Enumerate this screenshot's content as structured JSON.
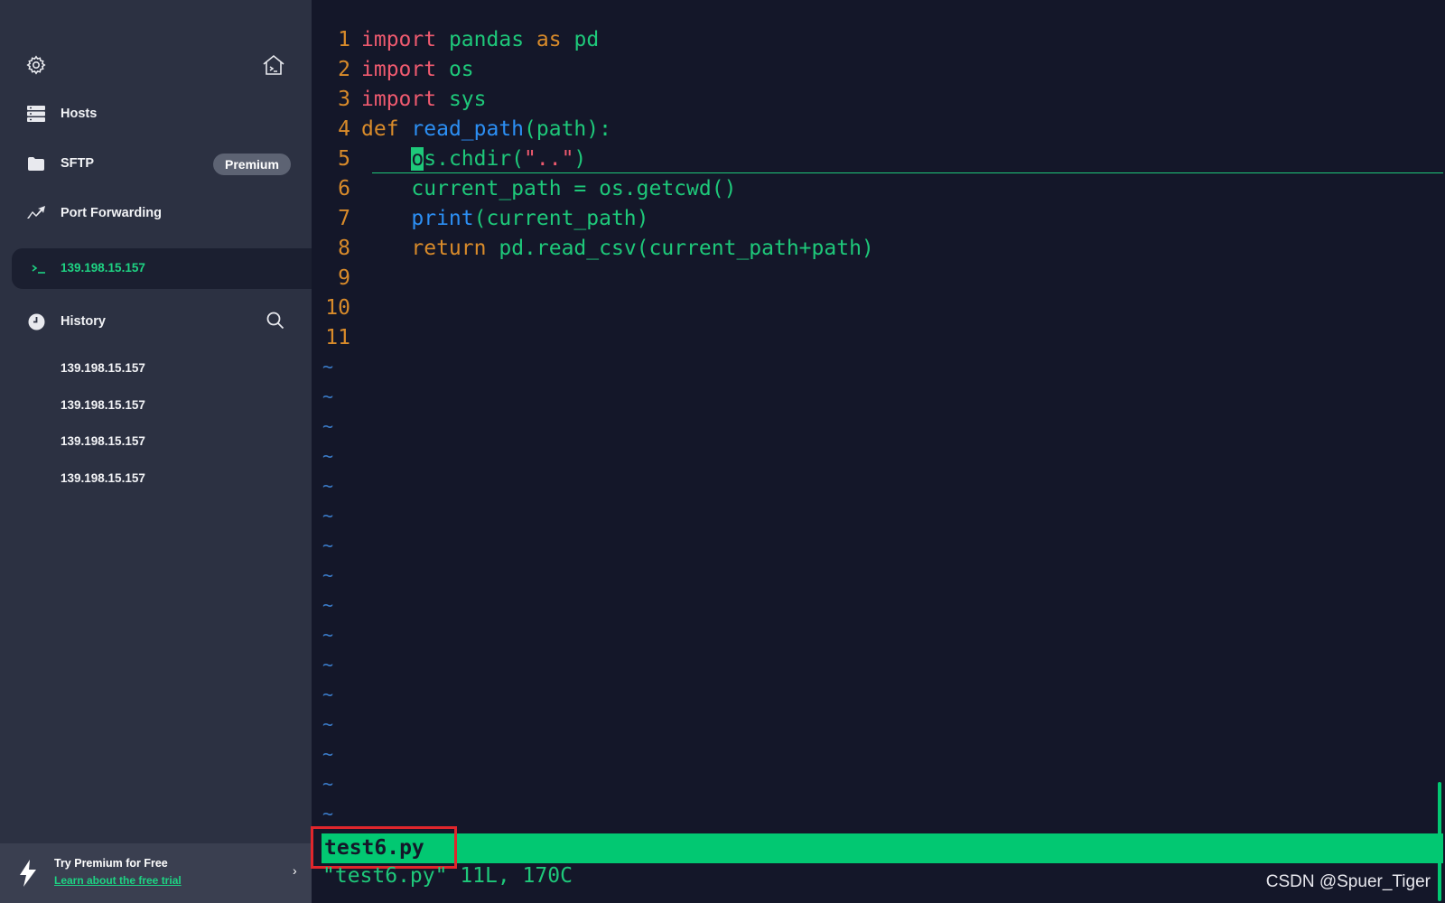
{
  "sidebar": {
    "nav": {
      "hosts": "Hosts",
      "sftp": "SFTP",
      "sftp_badge": "Premium",
      "port_forwarding": "Port Forwarding"
    },
    "active_session": "139.198.15.157",
    "history": {
      "label": "History",
      "items": [
        "139.198.15.157",
        "139.198.15.157",
        "139.198.15.157",
        "139.198.15.157"
      ]
    },
    "footer": {
      "title": "Try Premium for Free",
      "link": "Learn about the free trial",
      "chevron": "›"
    }
  },
  "window": {
    "minimize": "—",
    "maximize": "☐",
    "close": "✕",
    "dropdown": "⌄"
  },
  "terminal": {
    "lines": [
      {
        "n": "1",
        "tokens": [
          {
            "t": "kw",
            "v": "import"
          },
          {
            "t": "plain",
            "v": " "
          },
          {
            "t": "id",
            "v": "pandas"
          },
          {
            "t": "plain",
            "v": " "
          },
          {
            "t": "def",
            "v": "as"
          },
          {
            "t": "plain",
            "v": " "
          },
          {
            "t": "id",
            "v": "pd"
          }
        ]
      },
      {
        "n": "2",
        "tokens": [
          {
            "t": "kw",
            "v": "import"
          },
          {
            "t": "plain",
            "v": " "
          },
          {
            "t": "id",
            "v": "os"
          }
        ]
      },
      {
        "n": "3",
        "tokens": [
          {
            "t": "kw",
            "v": "import"
          },
          {
            "t": "plain",
            "v": " "
          },
          {
            "t": "id",
            "v": "sys"
          }
        ]
      },
      {
        "n": "4",
        "tokens": [
          {
            "t": "def",
            "v": "def"
          },
          {
            "t": "plain",
            "v": " "
          },
          {
            "t": "fn",
            "v": "read_path"
          },
          {
            "t": "id",
            "v": "(path):"
          }
        ]
      },
      {
        "n": "5",
        "tokens": [
          {
            "t": "plain",
            "v": "    "
          },
          {
            "t": "cursor",
            "v": "o"
          },
          {
            "t": "id",
            "v": "s.chdir("
          },
          {
            "t": "str",
            "v": "\"..\""
          },
          {
            "t": "id",
            "v": ")"
          }
        ]
      },
      {
        "n": "6",
        "tokens": [
          {
            "t": "plain",
            "v": "    "
          },
          {
            "t": "id",
            "v": "current_path = os.getcwd()"
          }
        ]
      },
      {
        "n": "7",
        "tokens": [
          {
            "t": "plain",
            "v": "    "
          },
          {
            "t": "fn",
            "v": "print"
          },
          {
            "t": "id",
            "v": "(current_path)"
          }
        ]
      },
      {
        "n": "8",
        "tokens": [
          {
            "t": "plain",
            "v": "    "
          },
          {
            "t": "def",
            "v": "return"
          },
          {
            "t": "plain",
            "v": " "
          },
          {
            "t": "id",
            "v": "pd.read_csv(current_path+path)"
          }
        ]
      },
      {
        "n": "9",
        "tokens": []
      },
      {
        "n": "10",
        "tokens": []
      },
      {
        "n": "11",
        "tokens": []
      }
    ],
    "tilde": "~",
    "tilde_count": 16,
    "status_filename": "test6.py",
    "cmdline": "\"test6.py\" 11L, 170C"
  },
  "watermark": "CSDN @Spuer_Tiger",
  "colors": {
    "accent": "#1ed383",
    "keyword": "#ef5a6f",
    "function": "#2c8ff4",
    "line_number": "#d98b2a",
    "statusbar": "#02c872",
    "highlight_box": "#e0262c"
  }
}
